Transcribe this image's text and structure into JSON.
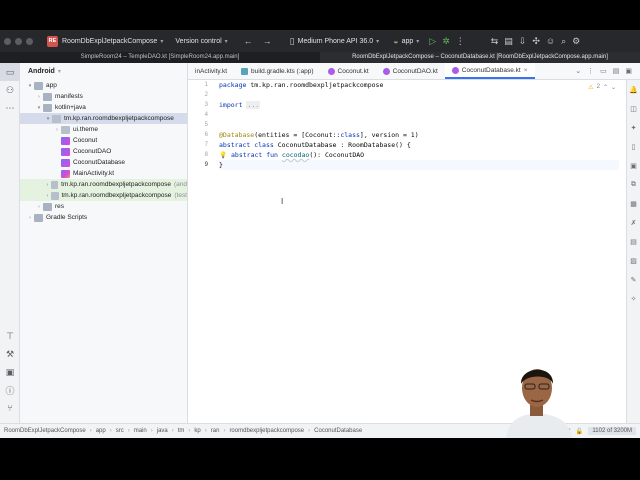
{
  "titlebar": {
    "project_badge": "RE",
    "project_name": "RoomDbExplJetpackCompose",
    "vcs": "Version control",
    "device": "Medium Phone API 36.0",
    "run_config": "app"
  },
  "project_tabs": [
    "SimpleRoom24 – TempleDAO.kt [SimpleRoom24.app.main]",
    "RoomDbExplJetpackCompose – CoconutDatabase.kt [RoomDbExplJetpackCompose.app.main]"
  ],
  "project_panel": {
    "view": "Android",
    "tree": [
      {
        "label": "app",
        "depth": 0,
        "icon": "folder",
        "arrow": "▾"
      },
      {
        "label": "manifests",
        "depth": 1,
        "icon": "folder",
        "arrow": "›"
      },
      {
        "label": "kotlin+java",
        "depth": 1,
        "icon": "folder",
        "arrow": "▾"
      },
      {
        "label": "tm.kp.ran.roomdbexpljetpackcompose",
        "depth": 2,
        "icon": "pkg",
        "arrow": "▾",
        "state": "sel"
      },
      {
        "label": "ui.theme",
        "depth": 3,
        "icon": "pkg",
        "arrow": "›"
      },
      {
        "label": "Coconut",
        "depth": 3,
        "icon": "k",
        "arrow": ""
      },
      {
        "label": "CoconutDAO",
        "depth": 3,
        "icon": "k",
        "arrow": ""
      },
      {
        "label": "CoconutDatabase",
        "depth": 3,
        "icon": "k",
        "arrow": ""
      },
      {
        "label": "MainActivity.kt",
        "depth": 3,
        "icon": "kt",
        "arrow": ""
      },
      {
        "label": "tm.kp.ran.roomdbexpljetpackcompose",
        "suffix": "(and",
        "depth": 2,
        "icon": "pkg",
        "arrow": "›",
        "state": "green"
      },
      {
        "label": "tm.kp.ran.roomdbexpljetpackcompose",
        "suffix": "(test",
        "depth": 2,
        "icon": "pkg",
        "arrow": "›",
        "state": "green"
      },
      {
        "label": "res",
        "depth": 1,
        "icon": "folder",
        "arrow": "›"
      },
      {
        "label": "Gradle Scripts",
        "depth": 0,
        "icon": "gradle",
        "arrow": "›"
      }
    ]
  },
  "editor_tabs": [
    {
      "label": "inActivity.kt",
      "icon": "kt",
      "active": false
    },
    {
      "label": "build.gradle.kts (:app)",
      "icon": "gradle",
      "active": false
    },
    {
      "label": "Coconut.kt",
      "icon": "k",
      "active": false
    },
    {
      "label": "CoconutDAO.kt",
      "icon": "k",
      "active": false
    },
    {
      "label": "CoconutDatabase.kt",
      "icon": "k",
      "active": true
    }
  ],
  "editor": {
    "inspection_count": "2",
    "line_numbers": [
      "1",
      "2",
      "3",
      "4",
      "5",
      "6",
      "7",
      "8",
      "9"
    ],
    "current_line": 9,
    "code": {
      "l1_kw": "package",
      "l1_rest": " tm.kp.ran.roomdbexpljetpackcompose",
      "l3_kw": "import",
      "l3_fold": "...",
      "l6_ann": "@Database",
      "l6_rest": "(entities = [Coconut::",
      "l6_kw": "class",
      "l6_rest2": "], version = 1)",
      "l7_kw": "abstract class",
      "l7_name": " CoconutDatabase",
      "l7_rest": " : RoomDatabase() {",
      "l8_kw": "abstract fun",
      "l8_fn": "cocodao",
      "l8_rest": "(): CoconutDAO",
      "l9": "}"
    }
  },
  "statusbar": {
    "breadcrumbs": [
      "RoomDbExplJetpackCompose",
      "app",
      "src",
      "main",
      "java",
      "tm",
      "kp",
      "ran",
      "roomdbexpljetpackcompose",
      "CoconutDatabase"
    ],
    "memory": "1102 of 3200M"
  },
  "colors": {
    "accent": "#3574f0",
    "titlebar": "#27282c",
    "project_badge": "#d3534e"
  }
}
